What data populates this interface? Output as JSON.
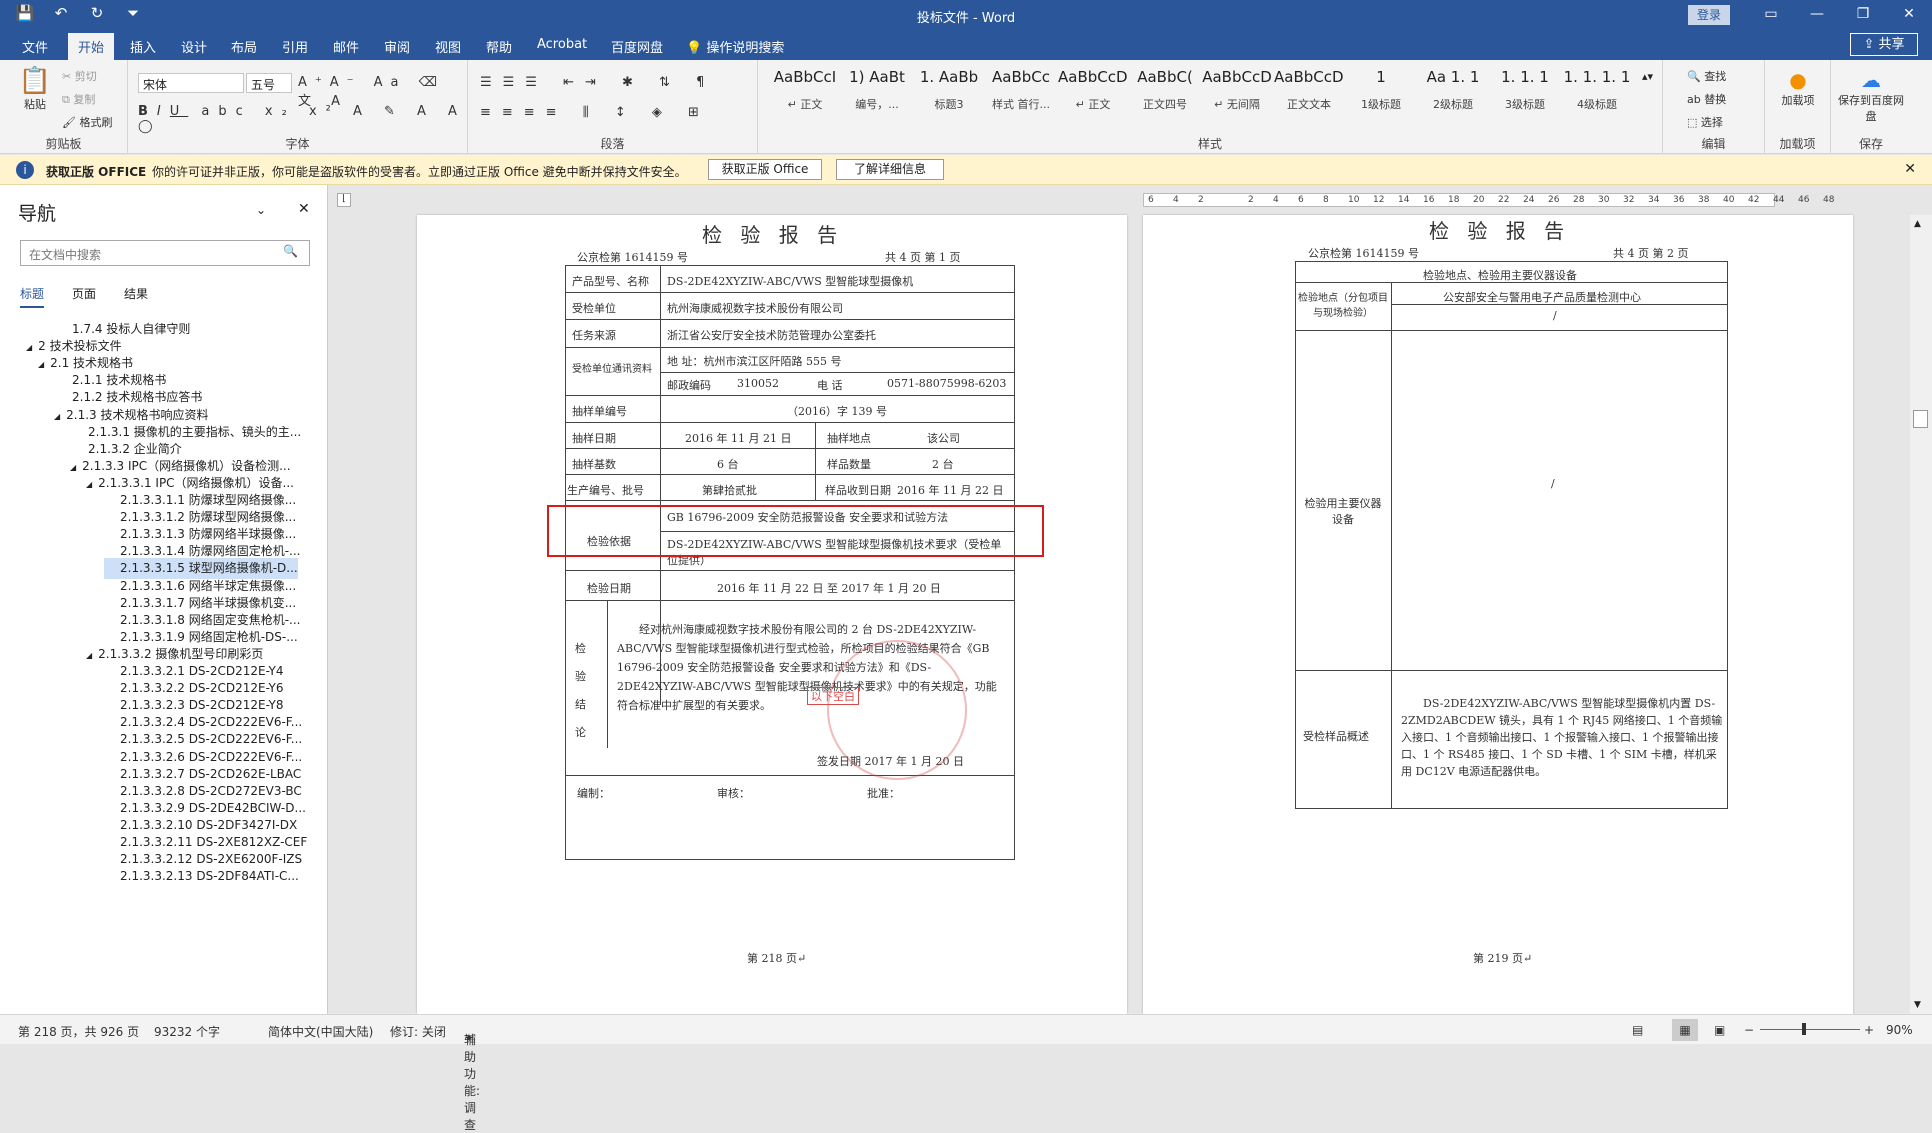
{
  "window": {
    "title": "投标文件 - Word",
    "login": "登录",
    "share": "共享"
  },
  "tabs": [
    "文件",
    "开始",
    "插入",
    "设计",
    "布局",
    "引用",
    "邮件",
    "审阅",
    "视图",
    "帮助",
    "Acrobat",
    "百度网盘"
  ],
  "tell_me": "操作说明搜索",
  "ribbon": {
    "clipboard": {
      "paste": "粘贴",
      "cut": "剪切",
      "copy": "复制",
      "painter": "格式刷",
      "label": "剪贴板"
    },
    "font": {
      "name": "宋体",
      "size": "五号",
      "label": "字体"
    },
    "paragraph": {
      "label": "段落"
    },
    "styles": {
      "label": "样式",
      "items": [
        {
          "preview": "AaBbCcI",
          "name": "↵ 正文"
        },
        {
          "preview": "1) AaBt",
          "name": "编号，..."
        },
        {
          "preview": "1. AaBb",
          "name": "标题3"
        },
        {
          "preview": "AaBbCc",
          "name": "样式 首行..."
        },
        {
          "preview": "AaBbCcDdI",
          "name": "↵ 正文"
        },
        {
          "preview": "AaBbC(",
          "name": "正文四号"
        },
        {
          "preview": "AaBbCcD",
          "name": "↵ 无间隔"
        },
        {
          "preview": "AaBbCcD(",
          "name": "正文文本"
        },
        {
          "preview": "1",
          "name": "1级标题"
        },
        {
          "preview": "Aa 1. 1",
          "name": "2级标题"
        },
        {
          "preview": "1. 1. 1",
          "name": "3级标题"
        },
        {
          "preview": "1. 1. 1. 1",
          "name": "4级标题"
        }
      ]
    },
    "editing": {
      "find": "查找",
      "replace": "替换",
      "select": "选择",
      "label": "编辑"
    },
    "addins": {
      "btn": "加载项",
      "label": "加载项"
    },
    "save": {
      "btn": "保存到百度网盘",
      "label": "保存"
    }
  },
  "message": {
    "title": "获取正版 OFFICE",
    "text": "你的许可证并非正版，你可能是盗版软件的受害者。立即通过正版 Office 避免中断并保持文件安全。",
    "btn1": "获取正版 Office",
    "btn2": "了解详细信息"
  },
  "nav": {
    "title": "导航",
    "search_placeholder": "在文档中搜索",
    "tabs": [
      "标题",
      "页面",
      "结果"
    ],
    "items": [
      {
        "t": "1.7.4 投标人自律守则",
        "l": 3,
        "a": ""
      },
      {
        "t": "2 技术投标文件",
        "l": 1,
        "a": "◢"
      },
      {
        "t": "2.1 技术规格书",
        "l": 2,
        "a": "◢"
      },
      {
        "t": "2.1.1 技术规格书",
        "l": 3,
        "a": ""
      },
      {
        "t": "2.1.2 技术规格书应答书",
        "l": 3,
        "a": ""
      },
      {
        "t": "2.1.3 技术规格书响应资料",
        "l": 3,
        "a": "◢"
      },
      {
        "t": "2.1.3.1 摄像机的主要指标、镜头的主...",
        "l": 4,
        "a": ""
      },
      {
        "t": "2.1.3.2 企业简介",
        "l": 4,
        "a": ""
      },
      {
        "t": "2.1.3.3 IPC（网络摄像机）设备检测...",
        "l": 4,
        "a": "◢"
      },
      {
        "t": "2.1.3.3.1 IPC（网络摄像机）设备...",
        "l": 5,
        "a": "◢"
      },
      {
        "t": "2.1.3.3.1.1 防爆球型网络摄像...",
        "l": 6,
        "a": ""
      },
      {
        "t": "2.1.3.3.1.2 防爆球型网络摄像...",
        "l": 6,
        "a": ""
      },
      {
        "t": "2.1.3.3.1.3 防爆网络半球摄像...",
        "l": 6,
        "a": ""
      },
      {
        "t": "2.1.3.3.1.4 防爆网络固定枪机-...",
        "l": 6,
        "a": ""
      },
      {
        "t": "2.1.3.3.1.5 球型网络摄像机-D...",
        "l": 6,
        "a": "",
        "sel": true
      },
      {
        "t": "2.1.3.3.1.6 网络半球定焦摄像...",
        "l": 6,
        "a": ""
      },
      {
        "t": "2.1.3.3.1.7 网络半球摄像机变...",
        "l": 6,
        "a": ""
      },
      {
        "t": "2.1.3.3.1.8 网络固定变焦枪机-...",
        "l": 6,
        "a": ""
      },
      {
        "t": "2.1.3.3.1.9 网络固定枪机-DS-...",
        "l": 6,
        "a": ""
      },
      {
        "t": "2.1.3.3.2 摄像机型号印刷彩页",
        "l": 5,
        "a": "◢"
      },
      {
        "t": "2.1.3.3.2.1 DS-2CD212E-Y4",
        "l": 6,
        "a": ""
      },
      {
        "t": "2.1.3.3.2.2 DS-2CD212E-Y6",
        "l": 6,
        "a": ""
      },
      {
        "t": "2.1.3.3.2.3 DS-2CD212E-Y8",
        "l": 6,
        "a": ""
      },
      {
        "t": "2.1.3.3.2.4 DS-2CD222EV6-F...",
        "l": 6,
        "a": ""
      },
      {
        "t": "2.1.3.3.2.5 DS-2CD222EV6-F...",
        "l": 6,
        "a": ""
      },
      {
        "t": "2.1.3.3.2.6 DS-2CD222EV6-F...",
        "l": 6,
        "a": ""
      },
      {
        "t": "2.1.3.3.2.7 DS-2CD262E-LBAC",
        "l": 6,
        "a": ""
      },
      {
        "t": "2.1.3.3.2.8 DS-2CD272EV3-BC",
        "l": 6,
        "a": ""
      },
      {
        "t": "2.1.3.3.2.9 DS-2DE42BCIW-D...",
        "l": 6,
        "a": ""
      },
      {
        "t": "2.1.3.3.2.10 DS-2DF3427I-DX",
        "l": 6,
        "a": ""
      },
      {
        "t": "2.1.3.3.2.11 DS-2XE812XZ-CEF",
        "l": 6,
        "a": ""
      },
      {
        "t": "2.1.3.3.2.12 DS-2XE6200F-IZS",
        "l": 6,
        "a": ""
      },
      {
        "t": "2.1.3.3.2.13 DS-2DF84ATI-C...",
        "l": 6,
        "a": ""
      }
    ]
  },
  "page1": {
    "title": "检 验 报 告",
    "no": "公京检第 1614159 号",
    "pages": "共 4 页  第 1 页",
    "rows": [
      [
        "产品型号、名称",
        "DS-2DE42XYZIW-ABC/VWS 型智能球型摄像机"
      ],
      [
        "受检单位",
        "杭州海康威视数字技术股份有限公司"
      ],
      [
        "任务来源",
        "浙江省公安厅安全技术防范管理办公室委托"
      ]
    ],
    "addr_label": "受检单位通讯资料",
    "addr": "地  址：杭州市滨江区阡陌路 555 号",
    "post_l": "邮政编码",
    "post": "310052",
    "tel_l": "电  话",
    "tel": "0571-88075998-6203",
    "sample_no_l": "抽样单编号",
    "sample_no": "（2016）字 139 号",
    "date_l": "抽样日期",
    "date": "2016 年 11 月 21 日",
    "place_l": "抽样地点",
    "place": "该公司",
    "base_l": "抽样基数",
    "base": "6 台",
    "qty_l": "样品数量",
    "qty": "2 台",
    "batch_l": "生产编号、批号",
    "batch": "第肆拾贰批",
    "recv_l": "样品收到日期",
    "recv": "2016 年 11 月 22 日",
    "basis_l": "检验依据",
    "basis1": "GB 16796-2009 安全防范报警设备 安全要求和试验方法",
    "basis2": "DS-2DE42XYZIW-ABC/VWS 型智能球型摄像机技术要求（受检单位提供）",
    "tdate_l": "检验日期",
    "tdate": "2016 年 11 月 22 日 至 2017 年 1 月 20 日",
    "concl_l": "检验结论",
    "concl": "经对杭州海康威视数字技术股份有限公司的 2 台 DS-2DE42XYZIW-ABC/VWS 型智能球型摄像机进行型式检验，所检项目的检验结果符合《GB 16796-2009 安全防范报警设备 安全要求和试验方法》和《DS-2DE42XYZIW-ABC/VWS 型智能球型摄像机技术要求》中的有关规定，功能符合标准中扩展型的有关要求。",
    "blank": "以下空白",
    "sign_date": "签发日期  2017 年 1 月 20 日",
    "sig1": "编制：",
    "sig2": "审核：",
    "sig3": "批准：",
    "footer": "第 218 页↵"
  },
  "page2": {
    "title": "检 验 报 告",
    "no": "公京检第 1614159 号",
    "pages": "共 4 页  第 2 页",
    "head": "检验地点、检验用主要仪器设备",
    "loc_l": "检验地点（分包项目与现场检验）",
    "loc": "公安部安全与警用电子产品质量检测中心",
    "slash": "/",
    "inst_l": "检验用主要仪器设备",
    "summ_l": "受检样品概述",
    "summ": "DS-2DE42XYZIW-ABC/VWS 型智能球型摄像机内置 DS-2ZMD2ABCDEW 镜头，具有 1 个 RJ45 网络接口、1 个音频输入接口、1 个音频输出接口、1 个报警输入接口、1 个报警输出接口、1 个 RS485 接口、1 个 SD 卡槽、1 个 SIM 卡槽，样机采用 DC12V 电源适配器供电。",
    "footer": "第 219 页↵"
  },
  "ruler": [
    "6",
    "4",
    "2",
    "",
    "2",
    "4",
    "6",
    "8",
    "10",
    "12",
    "14",
    "16",
    "18",
    "20",
    "22",
    "24",
    "26",
    "28",
    "30",
    "32",
    "34",
    "36",
    "38",
    "40",
    "42",
    "44",
    "46",
    "48"
  ],
  "status": {
    "page": "第 218 页，共 926 页",
    "words": "93232 个字",
    "lang": "简体中文(中国大陆)",
    "track": "修订: 关闭",
    "access": "辅助功能: 调查",
    "zoom": "90%"
  }
}
